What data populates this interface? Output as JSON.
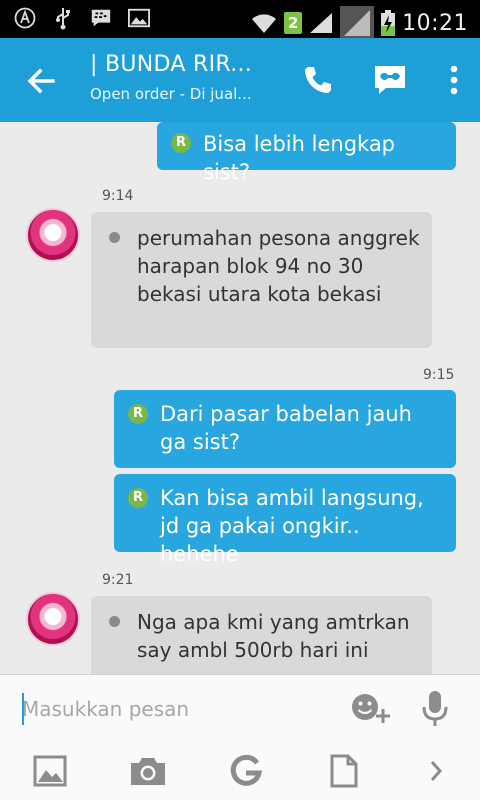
{
  "status_bar": {
    "clock": "10:21",
    "sim_badge": "2",
    "icons": [
      "android-icon",
      "usb-icon",
      "bbm-icon",
      "gallery-icon",
      "wifi-icon",
      "signal-icon",
      "battery-charging-icon"
    ]
  },
  "header": {
    "title": "| BUNDA RIR...",
    "subtitle": "Open order - Di jual...",
    "accent_color": "#1e9fd7"
  },
  "messages": [
    {
      "direction": "out",
      "text": "Bisa lebih lengkap sist?",
      "badge": "R"
    },
    {
      "direction": "in",
      "time": "9:14",
      "text": "perumahan pesona anggrek harapan blok 94 no 30 bekasi utara kota bekasi"
    },
    {
      "direction": "out",
      "time": "9:15",
      "text": "Dari pasar babelan jauh ga sist?",
      "badge": "R"
    },
    {
      "direction": "out",
      "text": "Kan bisa ambil langsung, jd ga pakai ongkir.. hehehe",
      "badge": "R"
    },
    {
      "direction": "in",
      "time": "9:21",
      "text": "Nga apa kmi yang amtrkan say ambl 500rb hari ini"
    }
  ],
  "composer": {
    "placeholder": "Masukkan pesan",
    "value": ""
  },
  "toolbar": {
    "icons": [
      "image-icon",
      "camera-icon",
      "google-icon",
      "file-icon",
      "chevron-right-icon"
    ]
  },
  "colors": {
    "outgoing_bubble": "#27a6df",
    "incoming_bubble": "#d9d9d9",
    "read_badge": "#7ab648"
  }
}
